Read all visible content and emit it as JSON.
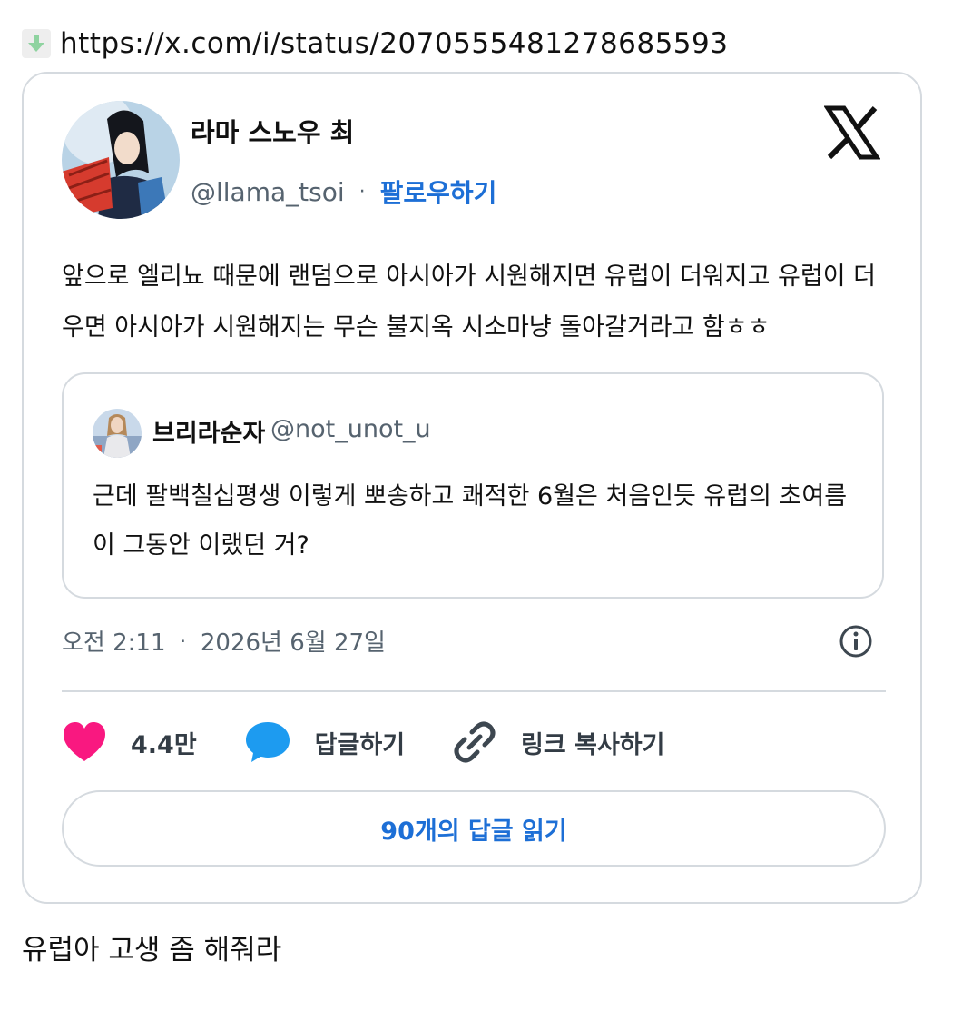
{
  "url": {
    "icon": "download-arrow-icon",
    "text": "https://x.com/i/status/2070555481278685593"
  },
  "tweet": {
    "author_name": "라마 스노우 최",
    "handle": "@llama_tsoi",
    "separator": "·",
    "follow_label": "팔로우하기",
    "platform_icon": "x-logo-icon",
    "text": "앞으로 엘리뇨 때문에 랜덤으로 아시아가 시원해지면 유럽이 더워지고 유럽이 더우면 아시아가 시원해지는 무슨 불지옥 시소마냥 돌아갈거라고 함ㅎㅎ",
    "quote": {
      "author_name": "브리라순자",
      "handle": "@not_unot_u",
      "text": "근데 팔백칠십평생 이렇게 뽀송하고 쾌적한 6월은 처음인듯 유럽의 초여름이 그동안 이랬던 거?"
    },
    "time": "오전 2:11",
    "date": "2026년 6월 27일",
    "info_icon": "info-icon",
    "actions": {
      "likes": "4.4만",
      "reply_label": "답글하기",
      "copy_link_label": "링크 복사하기"
    },
    "read_replies_label": "90개의 답글 읽기",
    "colors": {
      "accent": "#1d6fd6",
      "like": "#f91880",
      "reply": "#1d9bf0",
      "muted": "#56636f",
      "border": "#d5dadf"
    }
  },
  "caption": "유럽아 고생 좀 해줘라"
}
